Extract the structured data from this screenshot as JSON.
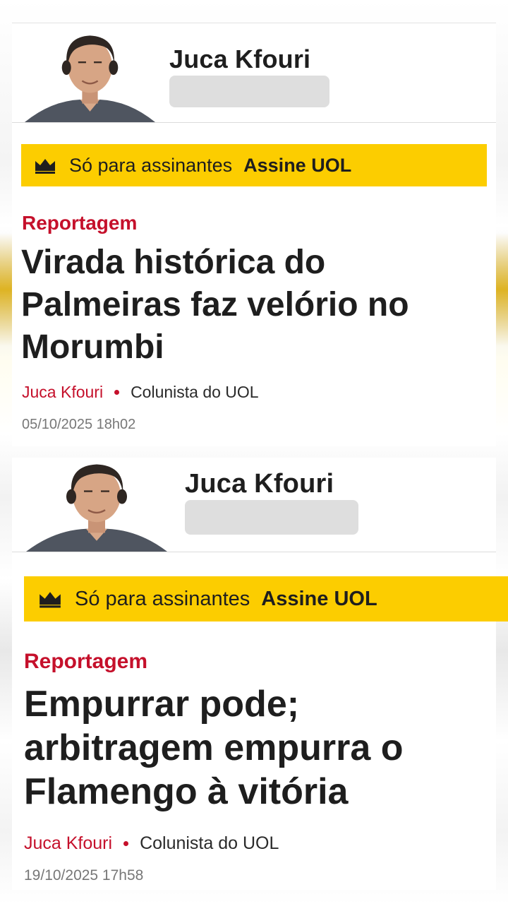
{
  "articles": [
    {
      "author": "Juca Kfouri",
      "subscription": {
        "text": "Só para assinantes",
        "link": "Assine UOL"
      },
      "category": "Reportagem",
      "headline": "Virada histórica do Palmeiras faz velório no Morumbi",
      "byline": {
        "author": "Juca Kfouri",
        "role": "Colunista do UOL"
      },
      "date": "05/10/2025 18h02"
    },
    {
      "author": "Juca Kfouri",
      "subscription": {
        "text": "Só para assinantes",
        "link": "Assine UOL"
      },
      "category": "Reportagem",
      "headline": "Empurrar pode; arbitragem empurra o Flamengo à vitória",
      "byline": {
        "author": "Juca Kfouri",
        "role": "Colunista do UOL"
      },
      "date": "19/10/2025 17h58"
    }
  ],
  "colors": {
    "accent": "#c5102b",
    "banner": "#fccd00",
    "text": "#1e1e1e"
  },
  "icons": {
    "crown": "crown-icon",
    "photo": "author-photo"
  }
}
